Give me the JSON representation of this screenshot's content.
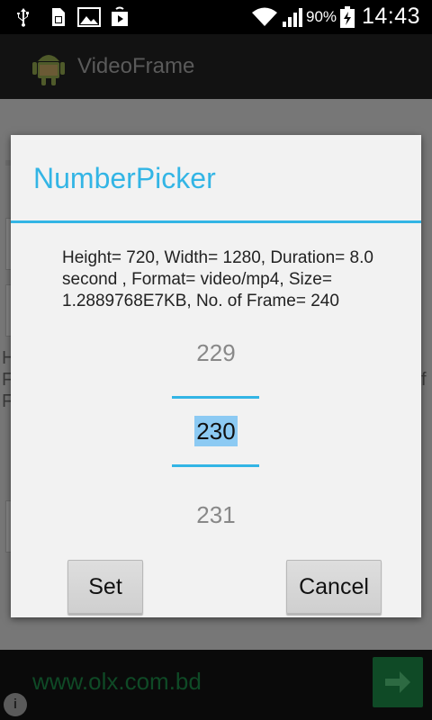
{
  "status_bar": {
    "battery_percent": "90%",
    "time": "14:43",
    "icons": [
      "usb-icon",
      "sim-icon",
      "image-icon",
      "play-store-icon",
      "wifi-icon",
      "signal-icon",
      "battery-charging-icon"
    ]
  },
  "app_bar": {
    "title": "VideoFrame",
    "icon": "android-icon"
  },
  "background": {
    "text_lines": [
      "H",
      "F",
      "F"
    ],
    "trailing_char": "f"
  },
  "dialog": {
    "title": "NumberPicker",
    "message": "Height= 720, Width= 1280, Duration= 8.0 second , Format= video/mp4, Size= 1.2889768E7KB, No. of Frame= 240",
    "picker": {
      "prev": "229",
      "current": "230",
      "next": "231"
    },
    "buttons": {
      "set": "Set",
      "cancel": "Cancel"
    }
  },
  "ad": {
    "text": "www.olx.com.bd",
    "info_icon": "i"
  },
  "colors": {
    "accent": "#33b5e5",
    "selection": "#8ccaf3",
    "ad_green": "#0f4a26"
  }
}
